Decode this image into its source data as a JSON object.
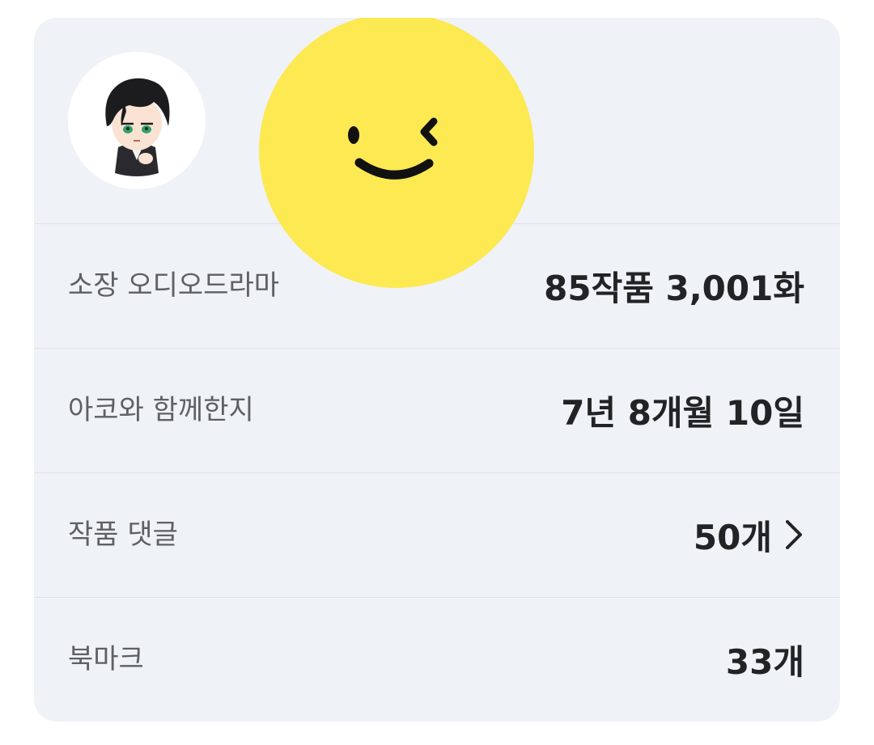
{
  "profile": {
    "avatar_icon": "chibi-character-avatar",
    "sticker_icon": "wink-smile-face"
  },
  "colors": {
    "card_bg": "#eff2f7",
    "sticker": "#fde952",
    "label": "#5e6066",
    "value": "#222325"
  },
  "stats": [
    {
      "label": "소장 오디오드라마",
      "value": "85작품 3,001화"
    },
    {
      "label": "아코와 함께한지",
      "value": "7년 8개월 10일"
    },
    {
      "label": "작품 댓글",
      "value": "50개",
      "icon": "chevron-right-icon"
    },
    {
      "label": "북마크",
      "value": "33개"
    }
  ]
}
